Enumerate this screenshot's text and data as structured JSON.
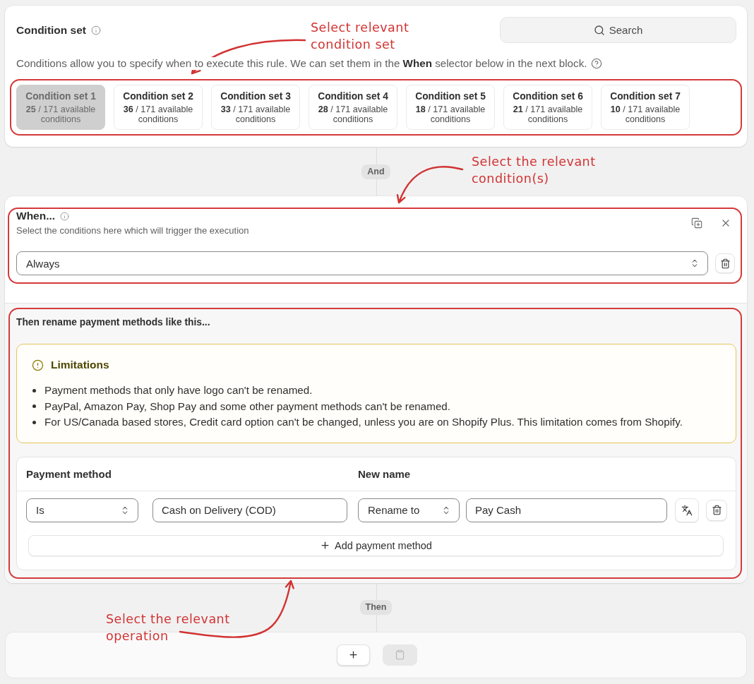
{
  "condition_set": {
    "title": "Condition set",
    "search": {
      "label": "Search"
    },
    "description": "Conditions allow you to specify when to execute this rule. We can set them in the **When** selector below in the next block.",
    "sets": [
      {
        "title": "Condition set 1",
        "summary": "**25** / 171 available conditions",
        "selected": true
      },
      {
        "title": "Condition set 2",
        "summary": "**36** / 171 available conditions",
        "selected": false
      },
      {
        "title": "Condition set 3",
        "summary": "**33** / 171 available conditions",
        "selected": false
      },
      {
        "title": "Condition set 4",
        "summary": "**28** / 171 available conditions",
        "selected": false
      },
      {
        "title": "Condition set 5",
        "summary": "**18** / 171 available conditions",
        "selected": false
      },
      {
        "title": "Condition set 6",
        "summary": "**21** / 171 available conditions",
        "selected": false
      },
      {
        "title": "Condition set 7",
        "summary": "**10** / 171 available conditions",
        "selected": false
      }
    ]
  },
  "and_connector": "And",
  "when": {
    "title": "When...",
    "subtitle": "Select the conditions here which will trigger the execution",
    "select": {
      "value": "Always"
    }
  },
  "rename": {
    "title": "Then rename payment methods like this...",
    "limitations": {
      "title": "Limitations",
      "items": [
        "Payment methods that only have logo can't be renamed.",
        "PayPal, Amazon Pay, Shop Pay and some other payment methods can't be renamed.",
        "For US/Canada based stores, Credit card option can't be changed, unless you are on Shopify Plus. This limitation comes from Shopify."
      ]
    },
    "table": {
      "columns": [
        "Payment method",
        "New name"
      ],
      "rows": [
        {
          "operator": "Is",
          "method": "Cash on Delivery (COD)",
          "action": "Rename to",
          "new_name": "Pay Cash"
        }
      ],
      "add_button": "Add payment method"
    }
  },
  "then_connector": "Then",
  "operation_bar": {
    "paste_button": {
      "disabled": true
    }
  },
  "annotations": [
    {
      "text": "Select relevant\ncondition set"
    },
    {
      "text": "Select the relevant\ncondition(s)"
    },
    {
      "text": "Select the relevant\noperation"
    }
  ]
}
